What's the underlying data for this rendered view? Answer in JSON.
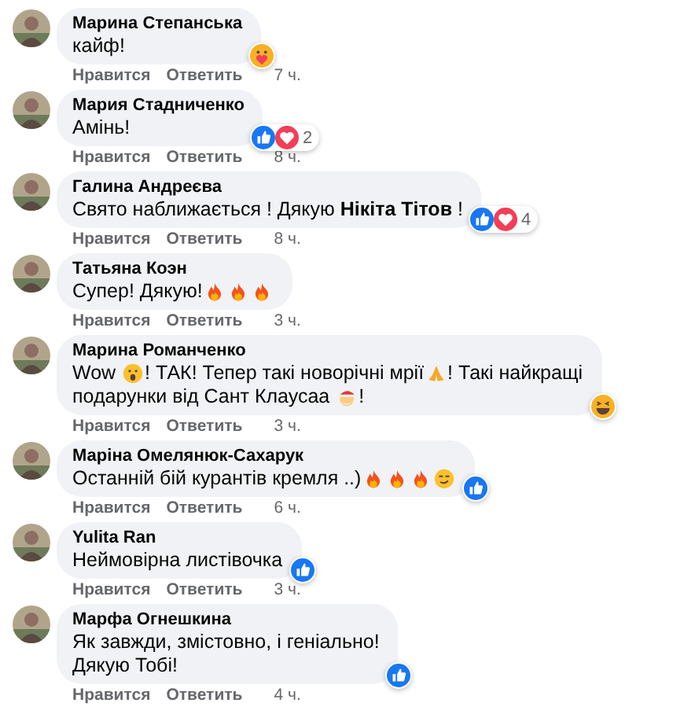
{
  "comments": [
    {
      "author": "Марина Степанська",
      "lines": [
        [
          {
            "kind": "text",
            "text": "кайф!"
          }
        ]
      ],
      "reactions": [
        {
          "kind": "care"
        }
      ],
      "actions": [
        "Нравится",
        "Ответить"
      ],
      "time": "7 ч."
    },
    {
      "author": "Мария Стадниченко",
      "lines": [
        [
          {
            "kind": "text",
            "text": "Амінь!"
          }
        ]
      ],
      "reactions": [
        {
          "kind": "like"
        },
        {
          "kind": "love"
        }
      ],
      "reaction_count": "2",
      "actions": [
        "Нравится",
        "Ответить"
      ],
      "time": "8 ч."
    },
    {
      "author": "Галина Андреєва",
      "lines": [
        [
          {
            "kind": "text",
            "text": "Свято наближається ! Дякую **Нікіта Тітов** !"
          }
        ]
      ],
      "reactions": [
        {
          "kind": "like"
        },
        {
          "kind": "love"
        }
      ],
      "reaction_count": "4",
      "actions": [
        "Нравится",
        "Ответить"
      ],
      "time": "8 ч."
    },
    {
      "author": "Татьяна Коэн",
      "lines": [
        [
          {
            "kind": "text",
            "text": "Супер! Дякую!"
          },
          {
            "kind": "fire"
          },
          {
            "kind": "fire"
          },
          {
            "kind": "fire"
          }
        ]
      ],
      "actions": [
        "Нравится",
        "Ответить"
      ],
      "time": "3 ч."
    },
    {
      "author": "Марина Романченко",
      "lines": [
        [
          {
            "kind": "text",
            "text": "Wow "
          },
          {
            "kind": "wow"
          },
          {
            "kind": "text",
            "text": "! ТАК! Тепер такі новорічні мрії"
          },
          {
            "kind": "pray"
          },
          {
            "kind": "text",
            "text": "! Такі найкращі"
          }
        ],
        [
          {
            "kind": "text",
            "text": "подарунки від Сант Клаусаа "
          },
          {
            "kind": "santa"
          },
          {
            "kind": "text",
            "text": "!"
          }
        ]
      ],
      "reactions": [
        {
          "kind": "haha"
        }
      ],
      "actions": [
        "Нравится",
        "Ответить"
      ],
      "time": "3 ч."
    },
    {
      "author": "Маріна Омелянюк-Сахарук",
      "lines": [
        [
          {
            "kind": "text",
            "text": "Останній бій курантів кремля ..)"
          },
          {
            "kind": "fire"
          },
          {
            "kind": "fire"
          },
          {
            "kind": "fire"
          },
          {
            "kind": "smirk"
          }
        ]
      ],
      "reactions": [
        {
          "kind": "like"
        }
      ],
      "actions": [
        "Нравится",
        "Ответить"
      ],
      "time": "6 ч."
    },
    {
      "author": "Yulita Ran",
      "lines": [
        [
          {
            "kind": "text",
            "text": "Неймовірна листівочка"
          }
        ]
      ],
      "reactions": [
        {
          "kind": "like"
        }
      ],
      "actions": [
        "Нравится",
        "Ответить"
      ],
      "time": "3 ч."
    },
    {
      "author": "Марфа Огнешкина",
      "lines": [
        [
          {
            "kind": "text",
            "text": "Як завжди, змістовно, і геніально!"
          }
        ],
        [
          {
            "kind": "text",
            "text": "Дякую Тобі!"
          }
        ]
      ],
      "reactions": [
        {
          "kind": "like"
        }
      ],
      "actions": [
        "Нравится",
        "Ответить"
      ],
      "time": "4 ч."
    }
  ]
}
